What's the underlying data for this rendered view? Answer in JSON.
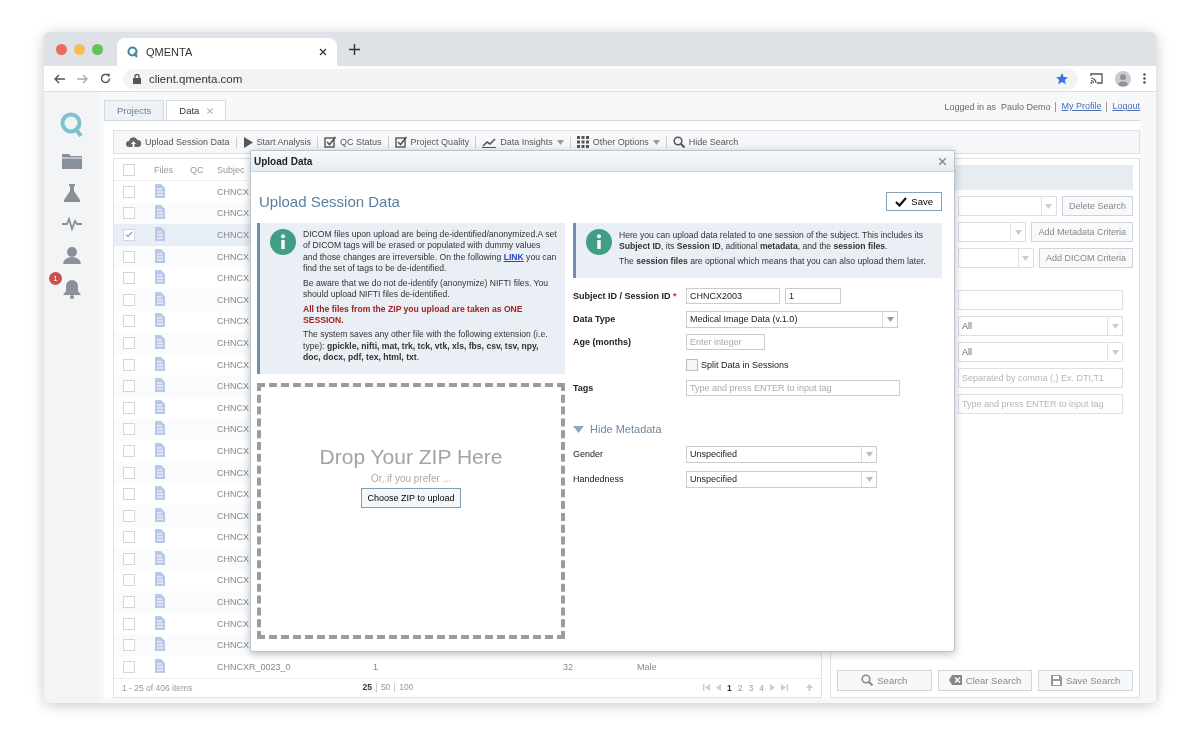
{
  "browser": {
    "tab_title": "QMENTA",
    "url": "client.qmenta.com"
  },
  "sidebar": {
    "notification_count": "1"
  },
  "app_tabs": [
    {
      "label": "Projects",
      "selected": false,
      "closable": false
    },
    {
      "label": "Data",
      "selected": true,
      "closable": true
    }
  ],
  "user_bar": {
    "prefix": "Logged in as",
    "user": "Paulo Demo",
    "links": [
      "My Profile",
      "Logout"
    ]
  },
  "toolbar": [
    {
      "label": "Upload Session Data",
      "dropdown": false
    },
    {
      "label": "Start Analysis",
      "dropdown": false
    },
    {
      "label": "QC Status",
      "dropdown": false
    },
    {
      "label": "Project Quality",
      "dropdown": false
    },
    {
      "label": "Data Insights",
      "dropdown": true
    },
    {
      "label": "Other Options",
      "dropdown": true
    },
    {
      "label": "Hide Search",
      "dropdown": false
    }
  ],
  "table": {
    "header_checked": false,
    "header": {
      "files": "Files",
      "qc": "QC",
      "subject": "Subjec"
    },
    "rows": [
      {
        "checked": false,
        "selected": false,
        "cells": [
          "CHNCX"
        ]
      },
      {
        "checked": false,
        "selected": false,
        "cells": [
          "CHNCX"
        ]
      },
      {
        "checked": true,
        "selected": true,
        "cells": [
          "CHNCX"
        ]
      },
      {
        "checked": false,
        "selected": false,
        "cells": [
          "CHNCX"
        ]
      },
      {
        "checked": false,
        "selected": false,
        "cells": [
          "CHNCX"
        ]
      },
      {
        "checked": false,
        "selected": false,
        "cells": [
          "CHNCX"
        ]
      },
      {
        "checked": false,
        "selected": false,
        "cells": [
          "CHNCX"
        ]
      },
      {
        "checked": false,
        "selected": false,
        "cells": [
          "CHNCX"
        ]
      },
      {
        "checked": false,
        "selected": false,
        "cells": [
          "CHNCX"
        ]
      },
      {
        "checked": false,
        "selected": false,
        "cells": [
          "CHNCX"
        ]
      },
      {
        "checked": false,
        "selected": false,
        "cells": [
          "CHNCX"
        ]
      },
      {
        "checked": false,
        "selected": false,
        "cells": [
          "CHNCX"
        ]
      },
      {
        "checked": false,
        "selected": false,
        "cells": [
          "CHNCX"
        ]
      },
      {
        "checked": false,
        "selected": false,
        "cells": [
          "CHNCX"
        ]
      },
      {
        "checked": false,
        "selected": false,
        "cells": [
          "CHNCX"
        ]
      },
      {
        "checked": false,
        "selected": false,
        "cells": [
          "CHNCX"
        ]
      },
      {
        "checked": false,
        "selected": false,
        "cells": [
          "CHNCX"
        ]
      },
      {
        "checked": false,
        "selected": false,
        "cells": [
          "CHNCX"
        ]
      },
      {
        "checked": false,
        "selected": false,
        "cells": [
          "CHNCX"
        ]
      },
      {
        "checked": false,
        "selected": false,
        "cells": [
          "CHNCX"
        ]
      },
      {
        "checked": false,
        "selected": false,
        "cells": [
          "CHNCX"
        ]
      },
      {
        "checked": false,
        "selected": false,
        "cells": [
          "CHNCX"
        ]
      },
      {
        "checked": false,
        "selected": false,
        "cells": [
          "CHNCXR_0023_0",
          "1",
          "32",
          "Male"
        ]
      }
    ]
  },
  "table_footer": {
    "range": "1 - 25 of 406 items",
    "page_sizes": [
      {
        "label": "25",
        "selected": true
      },
      {
        "label": "50",
        "selected": false
      },
      {
        "label": "100",
        "selected": false
      }
    ],
    "pages": [
      {
        "label": "1",
        "selected": true
      },
      {
        "label": "2",
        "selected": false
      },
      {
        "label": "3",
        "selected": false
      },
      {
        "label": "4",
        "selected": false
      }
    ]
  },
  "search_panel": {
    "rows": [
      {
        "kind": "select_button",
        "button": "Delete Search"
      },
      {
        "kind": "select_button",
        "button": "Add Metadata Criteria"
      },
      {
        "kind": "select_button",
        "button": "Add DICOM Criteria"
      },
      {
        "kind": "input"
      },
      {
        "kind": "select",
        "value": "All"
      },
      {
        "kind": "select",
        "value": "All"
      },
      {
        "kind": "input",
        "placeholder": "Separated by comma (,) Ex. DTI,T1"
      },
      {
        "kind": "input",
        "placeholder": "Type and press ENTER to input tag"
      }
    ],
    "buttons": [
      "Search",
      "Clear Search",
      "Save Search"
    ]
  },
  "dialog": {
    "title": "Upload Data",
    "heading": "Upload Session Data",
    "save_button": "Save",
    "left_info": [
      {
        "kind": "link",
        "before": "DICOM files upon upload are being de-identified/anonymized.A set of DICOM tags will be erased or populated with dummy values and those changes are irreversible. On the following ",
        "link": "LINK",
        "after": " you can find the set of tags to be de-identified."
      },
      {
        "kind": "plain",
        "text": "Be aware that we do not de-identify (anonymize) NIFTI files. You should upload NIFTI files de-identified."
      },
      {
        "kind": "warning",
        "text": "All the files from the ZIP you upload are taken as ONE SESSION."
      },
      {
        "kind": "plain",
        "text": "The system saves any other file with the following extension (i.e. type): **gpickle, nifti, mat, trk, tck, vtk, xls, fbs, csv, tsv, npy, doc, docx, pdf, tex, html, txt**."
      }
    ],
    "dropzone": {
      "title": "Drop Your ZIP Here",
      "subtitle": "Or, if you prefer ...",
      "button": "Choose ZIP to upload"
    },
    "right_info": [
      "Here you can upload data related to one session of the subject. This includes its **Subject ID**, its **Session ID**, aditional **metadata**, and the **session files**.",
      "The **session files** are optional which means that you can also upload them later."
    ],
    "form": [
      {
        "kind": "pair",
        "label": "Subject ID / Session ID",
        "required_mark": "*",
        "values": [
          "CHNCX2003",
          "1"
        ]
      },
      {
        "kind": "select",
        "label": "Data Type",
        "value": "Medical Image Data (v.1.0)"
      },
      {
        "kind": "input",
        "label": "Age (months)",
        "placeholder": "Enter integer"
      },
      {
        "kind": "checkbox",
        "label": "Split Data in Sessions",
        "checked": false
      },
      {
        "kind": "input",
        "label": "Tags",
        "placeholder": "Type and press ENTER to input tag"
      }
    ],
    "metadata": {
      "label": "Hide Metadata",
      "expanded": true,
      "fields": [
        {
          "label": "Gender",
          "value": "Unspecified"
        },
        {
          "label": "Handedness",
          "value": "Unspecified"
        }
      ]
    }
  }
}
